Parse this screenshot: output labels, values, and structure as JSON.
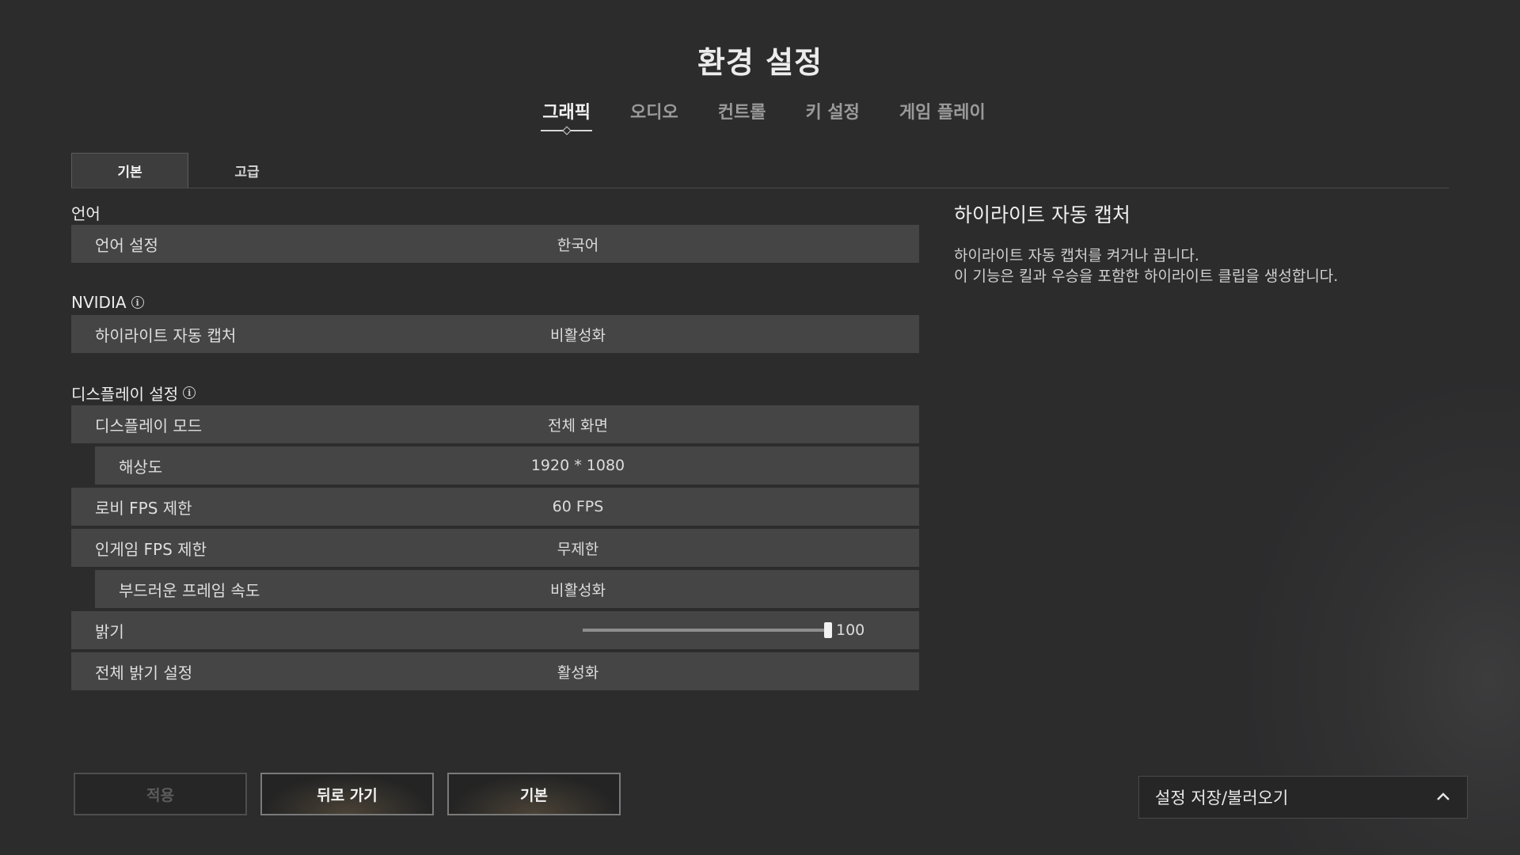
{
  "page_title": "환경 설정",
  "main_tabs": [
    {
      "label": "그래픽",
      "active": true
    },
    {
      "label": "오디오",
      "active": false
    },
    {
      "label": "컨트롤",
      "active": false
    },
    {
      "label": "키 설정",
      "active": false
    },
    {
      "label": "게임 플레이",
      "active": false
    }
  ],
  "sub_tabs": [
    {
      "label": "기본",
      "active": true
    },
    {
      "label": "고급",
      "active": false
    }
  ],
  "sections": {
    "language": {
      "title": "언어",
      "rows": [
        {
          "label": "언어 설정",
          "value": "한국어"
        }
      ]
    },
    "nvidia": {
      "title": "NVIDIA",
      "rows": [
        {
          "label": "하이라이트 자동 캡처",
          "value": "비활성화"
        }
      ]
    },
    "display": {
      "title": "디스플레이 설정",
      "rows": [
        {
          "label": "디스플레이 모드",
          "value": "전체 화면"
        },
        {
          "label": "해상도",
          "value": "1920 * 1080"
        },
        {
          "label": "로비 FPS 제한",
          "value": "60 FPS"
        },
        {
          "label": "인게임 FPS 제한",
          "value": "무제한"
        },
        {
          "label": "부드러운 프레임 속도",
          "value": "비활성화"
        },
        {
          "label": "밝기",
          "value": "100",
          "slider_fraction": 1.0
        },
        {
          "label": "전체 밝기 설정",
          "value": "활성화"
        }
      ]
    }
  },
  "detail": {
    "title": "하이라이트 자동 캡처",
    "line1": "하이라이트 자동 캡처를 켜거나 끕니다.",
    "line2": "이 기능은 킬과 우승을 포함한 하이라이트 클립을 생성합니다."
  },
  "buttons": {
    "apply": "적용",
    "back": "뒤로 가기",
    "default": "기본"
  },
  "save_load": {
    "label": "설정 저장/불러오기",
    "icon": "chevron-up-icon"
  },
  "colors": {
    "background": "#2c2c2d",
    "row": "#454546",
    "text": "#e6e6e6"
  }
}
